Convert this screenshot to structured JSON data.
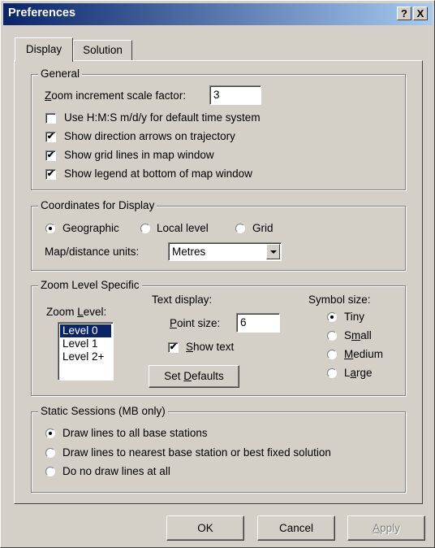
{
  "window": {
    "title": "Preferences",
    "help_label": "?",
    "close_label": "X"
  },
  "tabs": [
    {
      "label": "Display"
    },
    {
      "label": "Solution"
    }
  ],
  "general": {
    "legend": "General",
    "zoom_label_u": "Z",
    "zoom_label_rest": "oom increment scale factor:",
    "zoom_value": "3",
    "checkboxes": [
      {
        "label": "Use H:M:S m/d/y for default time system",
        "checked": false
      },
      {
        "label": "Show direction arrows on trajectory",
        "checked": true
      },
      {
        "label": "Show grid lines in map window",
        "checked": true
      },
      {
        "label": "Show legend at bottom of map window",
        "checked": true
      }
    ]
  },
  "coordinates": {
    "legend": "Coordinates for Display",
    "radios": [
      {
        "label": "Geographic",
        "selected": true
      },
      {
        "label": "Local level",
        "selected": false
      },
      {
        "label": "Grid",
        "selected": false
      }
    ],
    "units_label": "Map/distance units:",
    "units_value": "Metres"
  },
  "zoom_level": {
    "legend": "Zoom Level Specific",
    "zoom_level_label_a": "Zoom ",
    "zoom_level_label_u": "L",
    "zoom_level_label_b": "evel:",
    "levels": [
      "Level 0",
      "Level 1",
      "Level 2+"
    ],
    "selected_level": "Level 0",
    "text_display_label": "Text display:",
    "point_size_label_u": "P",
    "point_size_label_rest": "oint size:",
    "point_size_value": "6",
    "show_text_u": "S",
    "show_text_rest": "how text",
    "show_text_checked": true,
    "set_defaults_a": "Set ",
    "set_defaults_u": "D",
    "set_defaults_b": "efaults",
    "symbol_size_label": "Symbol size:",
    "symbol_sizes": [
      {
        "a": "Tiny",
        "u": "",
        "b": "",
        "selected": true
      },
      {
        "a": "S",
        "u": "m",
        "b": "all",
        "selected": false
      },
      {
        "a": "",
        "u": "M",
        "b": "edium",
        "selected": false
      },
      {
        "a": "L",
        "u": "a",
        "b": "rge",
        "selected": false
      }
    ]
  },
  "static_sessions": {
    "legend": "Static Sessions (MB only)",
    "radios": [
      {
        "label": "Draw lines to all base stations",
        "selected": true
      },
      {
        "label": "Draw lines to nearest base station or best fixed solution",
        "selected": false
      },
      {
        "label": "Do no draw lines at all",
        "selected": false
      }
    ]
  },
  "buttons": {
    "ok": "OK",
    "cancel": "Cancel",
    "apply_u": "A",
    "apply_rest": "pply"
  }
}
